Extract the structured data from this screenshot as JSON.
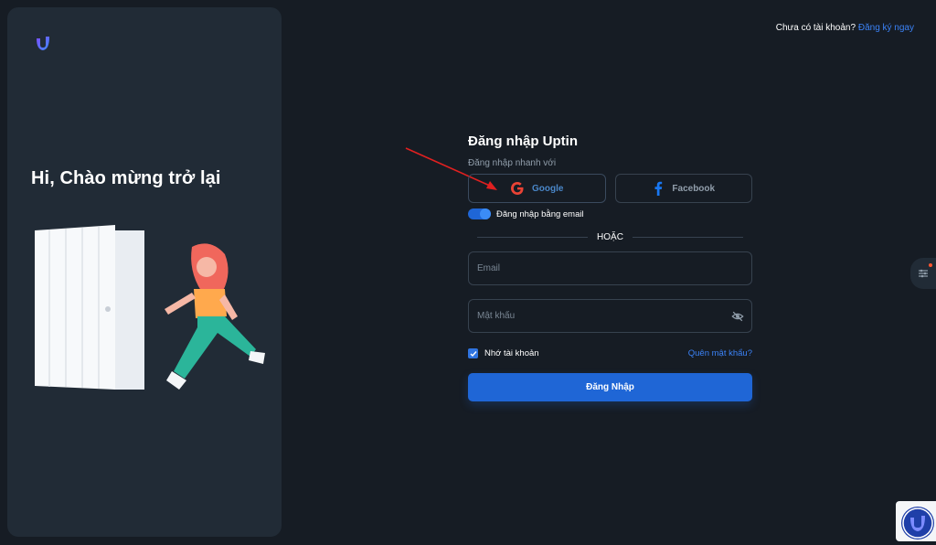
{
  "left_panel": {
    "welcome_text": "Hi, Chào mừng trở lại"
  },
  "header": {
    "no_account_text": "Chưa có tài khoản?",
    "register_link": "Đăng ký ngay"
  },
  "form": {
    "title": "Đăng nhập Uptin",
    "quick_login_label": "Đăng nhập nhanh với",
    "google_label": "Google",
    "facebook_label": "Facebook",
    "email_toggle_label": "Đăng nhập bằng email",
    "divider_label": "HOẶC",
    "email_placeholder": "Email",
    "password_placeholder": "Mật khẩu",
    "remember_label": "Nhớ tài khoản",
    "forgot_link": "Quên mật khẩu?",
    "submit_label": "Đăng Nhập"
  },
  "colors": {
    "background": "#161c24",
    "panel": "#212b36",
    "accent": "#1f66d6",
    "link": "#3b82f6",
    "google_red": "#ea4335",
    "facebook_blue": "#1877f2"
  },
  "icons": [
    "app-logo-icon",
    "google-icon",
    "facebook-icon",
    "eye-off-icon",
    "check-icon",
    "settings-icon"
  ]
}
